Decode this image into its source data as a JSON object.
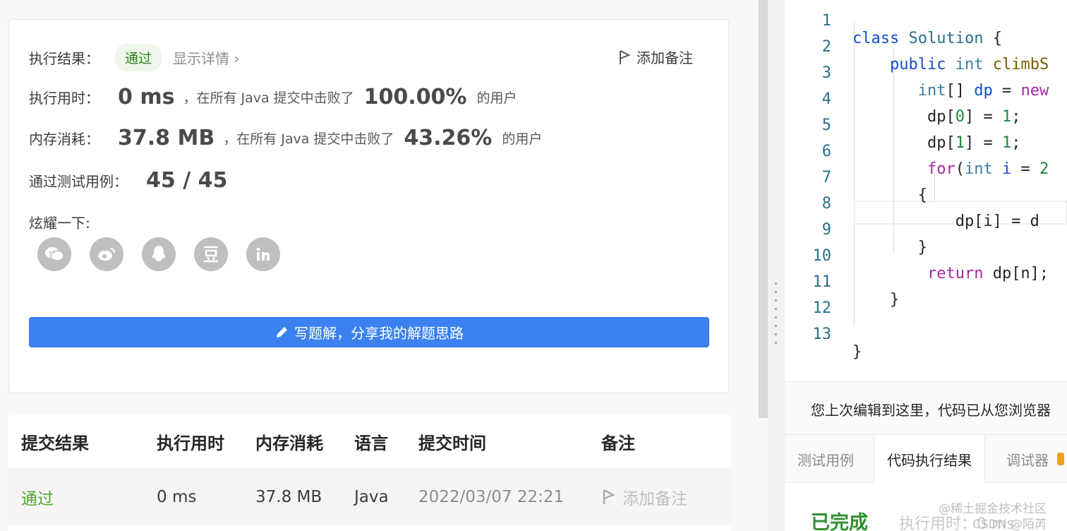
{
  "result_card": {
    "status_label": "执行结果：",
    "status_value": "通过",
    "detail_link": "显示详情",
    "add_note": "添加备注",
    "runtime_label": "执行用时：",
    "runtime_value": "0 ms",
    "runtime_prefix": "，在所有 Java 提交中击败了",
    "runtime_percent": "100.00%",
    "runtime_suffix": "的用户",
    "memory_label": "内存消耗：",
    "memory_value": "37.8 MB",
    "memory_prefix": "，在所有 Java 提交中击败了",
    "memory_percent": "43.26%",
    "memory_suffix": "的用户",
    "testcase_label": "通过测试用例：",
    "testcase_value": "45 / 45",
    "share_label": "炫耀一下:",
    "share_icons": [
      "wechat-icon",
      "weibo-icon",
      "qq-icon",
      "douban-icon",
      "linkedin-icon"
    ],
    "write_button": "写题解，分享我的解题思路"
  },
  "submissions": {
    "headers": [
      "提交结果",
      "执行用时",
      "内存消耗",
      "语言",
      "提交时间",
      "备注"
    ],
    "rows": [
      {
        "result": "通过",
        "runtime": "0 ms",
        "memory": "37.8 MB",
        "language": "Java",
        "time": "2022/03/07 22:21",
        "note": "添加备注"
      }
    ]
  },
  "editor": {
    "lines": [
      {
        "n": "1",
        "code": "class Solution {"
      },
      {
        "n": "2",
        "code": "    public int climbS"
      },
      {
        "n": "3",
        "code": "      int[] dp = new"
      },
      {
        "n": "4",
        "code": "       dp[0] = 1;"
      },
      {
        "n": "5",
        "code": "       dp[1] = 1;"
      },
      {
        "n": "6",
        "code": "       for(int i = 2"
      },
      {
        "n": "7",
        "code": "       {"
      },
      {
        "n": "8",
        "code": "           dp[i] = d"
      },
      {
        "n": "9",
        "code": "       }"
      },
      {
        "n": "10",
        "code": "       return dp[n];"
      },
      {
        "n": "11",
        "code": "    }"
      },
      {
        "n": "12",
        "code": ""
      },
      {
        "n": "13",
        "code": "}"
      }
    ],
    "notice": "您上次编辑到这里，代码已从您浏览器",
    "tabs": [
      "测试用例",
      "代码执行结果",
      "调试器"
    ],
    "done_label": "已完成",
    "exec_label": "执行用时：0 ms"
  },
  "watermark": {
    "line1": "@稀土掘金技术社区",
    "line2": "CSDN @陌芮"
  },
  "colors": {
    "accent": "#3b82f0",
    "pass": "#52a52e",
    "done": "#2f8f2f"
  }
}
